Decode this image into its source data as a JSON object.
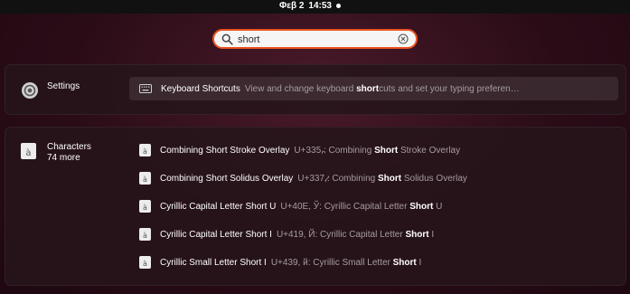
{
  "topbar": {
    "date": "Φεβ 2",
    "time": "14:53"
  },
  "search": {
    "value": "short",
    "placeholder": ""
  },
  "settings_provider": {
    "name": "Settings",
    "result": {
      "title": "Keyboard Shortcuts",
      "desc_pre": "View and change keyboard ",
      "desc_match": "short",
      "desc_post": "cuts and set your typing preferen…"
    }
  },
  "characters_provider": {
    "name": "Characters",
    "more": "74 more",
    "icon_glyph": "à",
    "results": [
      {
        "title": "Combining Short Stroke Overlay",
        "code": "U+335,",
        "glyph": "̵",
        "desc_pre": ": Combining ",
        "match": "Short",
        "desc_post": " Stroke Overlay"
      },
      {
        "title": "Combining Short Solidus Overlay",
        "code": "U+337,",
        "glyph": "̷",
        "desc_pre": ": Combining ",
        "match": "Short",
        "desc_post": " Solidus Overlay"
      },
      {
        "title": "Cyrillic Capital Letter Short U",
        "code": "U+40E,",
        "glyph": " Ў",
        "desc_pre": ": Cyrillic Capital Letter ",
        "match": "Short",
        "desc_post": " U"
      },
      {
        "title": "Cyrillic Capital Letter Short I",
        "code": "U+419,",
        "glyph": " Й",
        "desc_pre": ": Cyrillic Capital Letter ",
        "match": "Short",
        "desc_post": " I"
      },
      {
        "title": "Cyrillic Small Letter Short I",
        "code": "U+439,",
        "glyph": " й",
        "desc_pre": ": Cyrillic Small Letter ",
        "match": "Short",
        "desc_post": " I"
      }
    ]
  },
  "colors": {
    "accent": "#e95420",
    "panel": "#26141a",
    "muted_text": "#a59da0"
  }
}
